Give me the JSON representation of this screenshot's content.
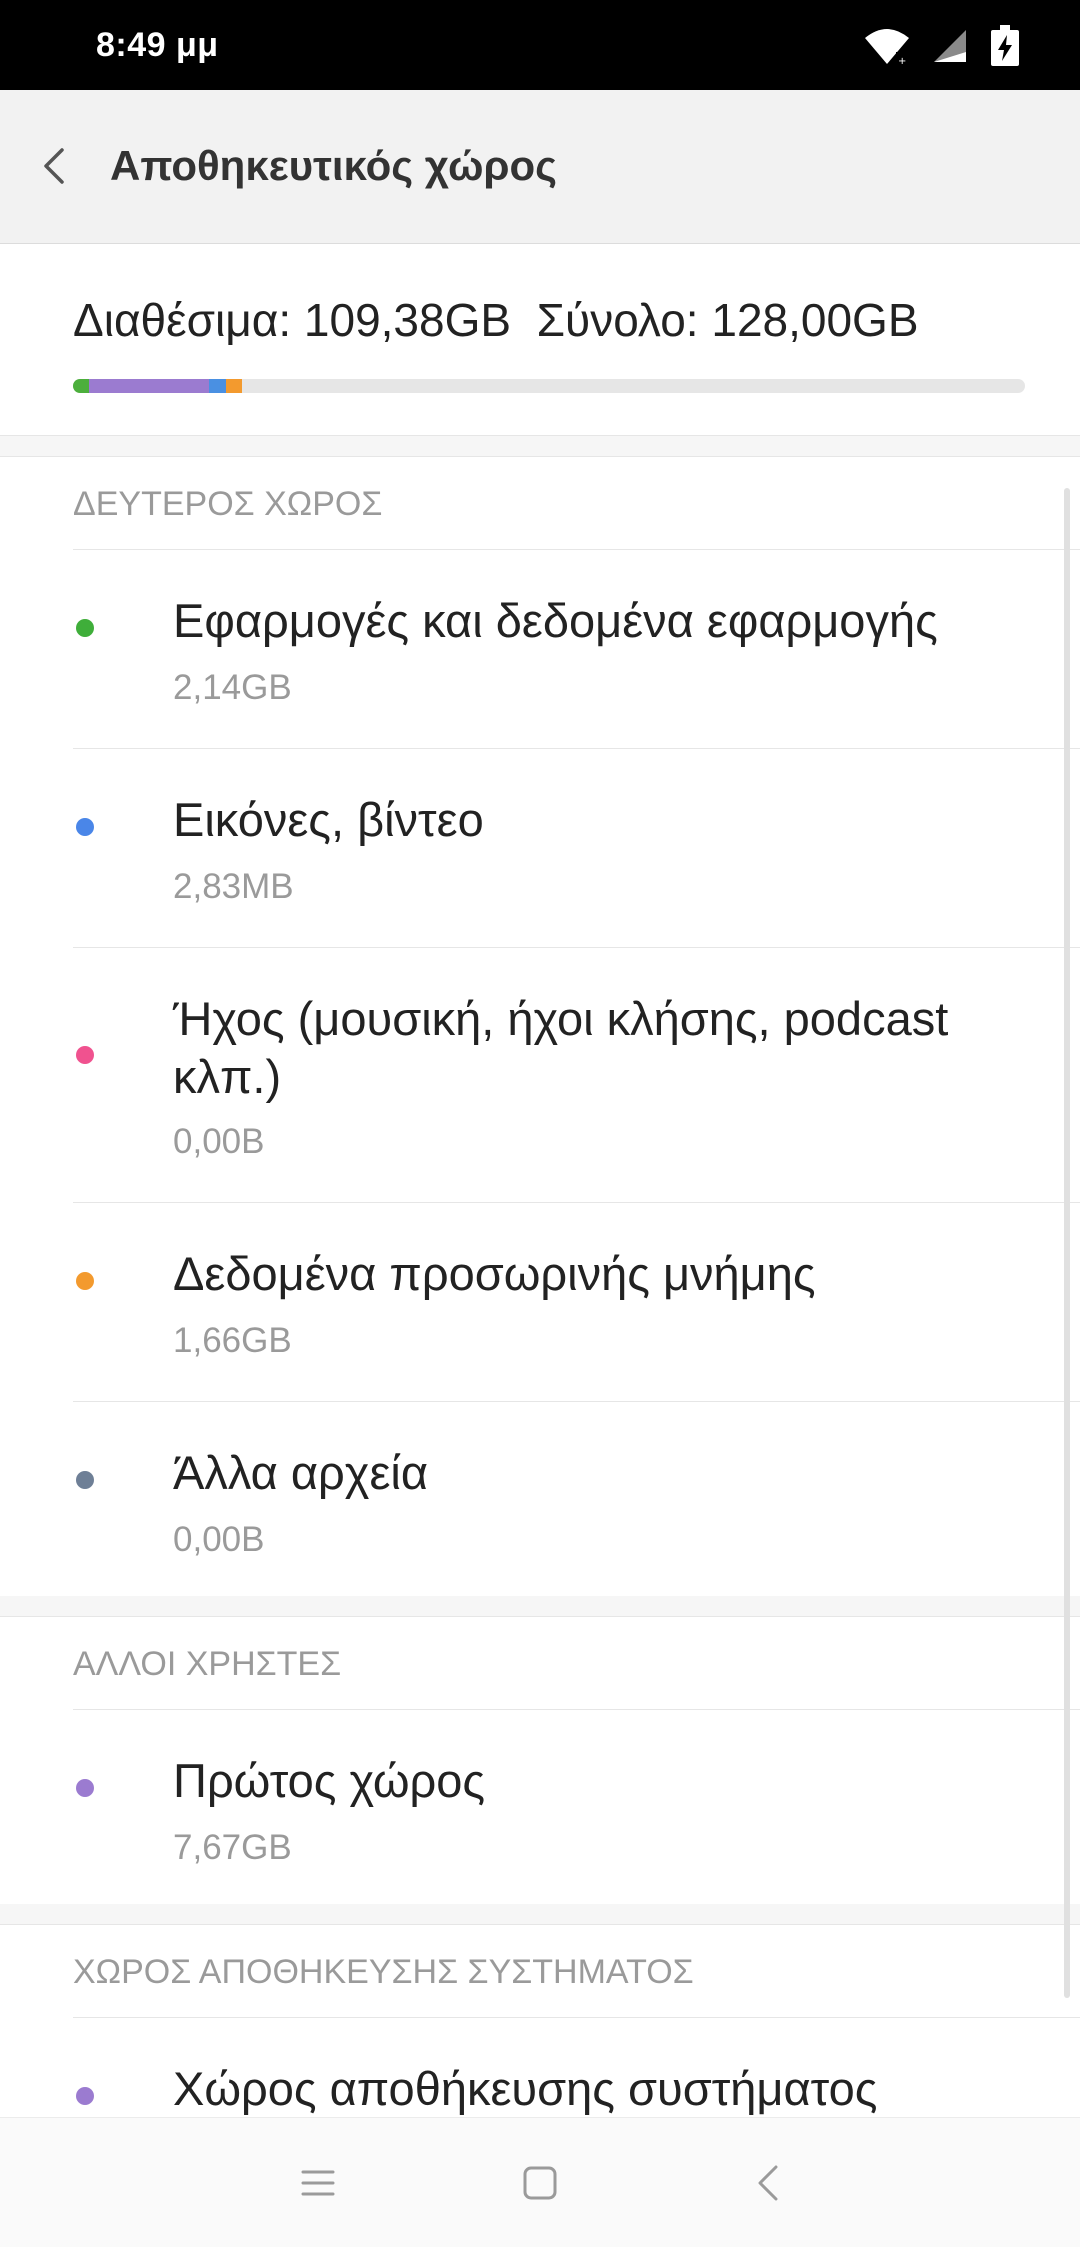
{
  "status_bar": {
    "time": "8:49 μμ",
    "icons": [
      "wifi-icon",
      "signal-icon",
      "battery-charging-icon"
    ]
  },
  "app_bar": {
    "back_icon": "chevron-left-icon",
    "title": "Αποθηκευτικός χώρος"
  },
  "summary": {
    "text": "Διαθέσιμα: 109,38GB  Σύνολο: 128,00GB",
    "usage_segments": [
      {
        "color": "#4caf3c",
        "fraction": 0.0167
      },
      {
        "color": "#9b7bd0",
        "fraction": 0.126
      },
      {
        "color": "#4a90e2",
        "fraction": 0.018
      },
      {
        "color": "#f39a2e",
        "fraction": 0.0167
      }
    ]
  },
  "sections": [
    {
      "header": "ΔΕΥΤΕΡΟΣ ΧΩΡΟΣ",
      "items": [
        {
          "title": "Εφαρμογές και δεδομένα εφαρμογής",
          "size": "2,14GB",
          "color": "#3fae3a"
        },
        {
          "title": "Εικόνες, βίντεο",
          "size": "2,83MB",
          "color": "#4a86e8"
        },
        {
          "title": "Ήχος (μουσική, ήχοι κλήσης, podcast κλπ.)",
          "size": "0,00B",
          "color": "#f0528f"
        },
        {
          "title": "Δεδομένα προσωρινής μνήμης",
          "size": "1,66GB",
          "color": "#f39a2e"
        },
        {
          "title": "Άλλα αρχεία",
          "size": "0,00B",
          "color": "#6e7f96"
        }
      ]
    },
    {
      "header": "ΑΛΛΟΙ ΧΡΗΣΤΕΣ",
      "items": [
        {
          "title": "Πρώτος χώρος",
          "size": "7,67GB",
          "color": "#9b7bd0"
        }
      ]
    },
    {
      "header": "ΧΩΡΟΣ ΑΠΟΘΗΚΕΥΣΗΣ ΣΥΣΤΗΜΑΤΟΣ",
      "items": [
        {
          "title": "Χώρος αποθήκευσης συστήματος",
          "size": "",
          "color": "#9b7bd0"
        }
      ]
    }
  ],
  "nav_bar": {
    "icons": [
      "menu-icon",
      "home-icon",
      "back-icon"
    ]
  }
}
